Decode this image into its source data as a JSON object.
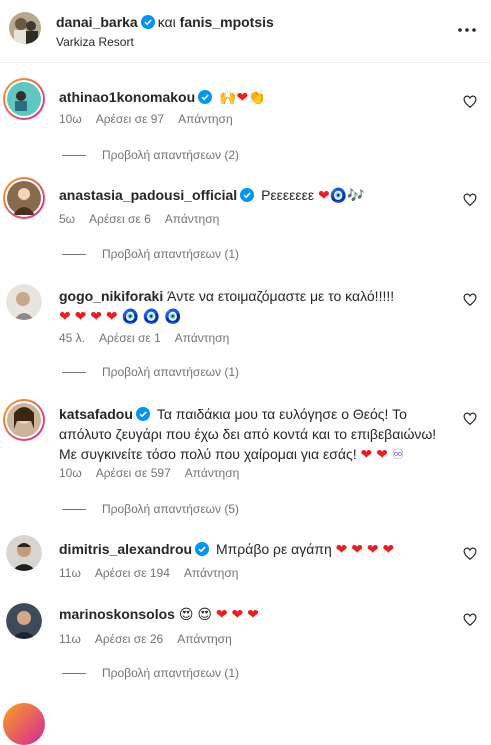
{
  "header": {
    "user1": "danai_barka",
    "connector": "και",
    "user2": "fanis_mpotsis",
    "location": "Varkiza Resort"
  },
  "comments": [
    {
      "user": "athinao1konomakou",
      "text": "",
      "emoji": [
        "🙌",
        "❤",
        "👏"
      ],
      "time": "10ω",
      "likes": "Αρέσει σε 97",
      "reply": "Απάντηση",
      "replies": "Προβολή απαντήσεων (2)"
    },
    {
      "user": "anastasia_padousi_official",
      "text": "Ρεεεεεεε",
      "emoji": [
        "❤",
        "🧿",
        "🎶"
      ],
      "time": "5ω",
      "likes": "Αρέσει σε 6",
      "reply": "Απάντηση",
      "replies": "Προβολή απαντήσεων (1)"
    },
    {
      "user": "gogo_nikiforaki",
      "text": "Άντε να ετοιμαζόμαστε με το καλό!!!!!",
      "emoji": [
        "❤",
        "❤",
        "❤",
        "❤",
        "🧿",
        "🧿",
        "🧿"
      ],
      "time": "45 λ.",
      "likes": "Αρέσει σε 1",
      "reply": "Απάντηση",
      "replies": "Προβολή απαντήσεων (1)"
    },
    {
      "user": "katsafadou",
      "text": "Τα παιδάκια μου τα ευλόγησε ο Θεός! Το απόλυτο ζευγάρι που έχω δει από κοντά και το επιβεβαιώνω! Με συγκινείτε τόσο πολύ που χαίρομαι για εσάς!",
      "emoji": [
        "❤",
        "❤",
        "♾"
      ],
      "time": "10ω",
      "likes": "Αρέσει σε 597",
      "reply": "Απάντηση",
      "replies": "Προβολή απαντήσεων (5)"
    },
    {
      "user": "dimitris_alexandrou",
      "text": "Μπράβο ρε αγάπη",
      "emoji": [
        "❤",
        "❤",
        "❤",
        "❤"
      ],
      "time": "11ω",
      "likes": "Αρέσει σε 194",
      "reply": "Απάντηση",
      "replies": "Προβολή απαντήσεων (1)"
    },
    {
      "user": "marinoskonsolos",
      "text": "",
      "emoji": [
        "😍",
        "😍",
        "❤",
        "❤",
        "❤"
      ],
      "time": "11ω",
      "likes": "Αρέσει σε 26",
      "reply": "Απάντηση",
      "replies": "Προβολή απαντήσεων (1)"
    }
  ],
  "colors": {
    "verified": "#0095f6",
    "heart": "#ed1c24",
    "muted": "#737373",
    "story_ring_start": "#f9a31c",
    "story_ring_end": "#d6249f"
  }
}
